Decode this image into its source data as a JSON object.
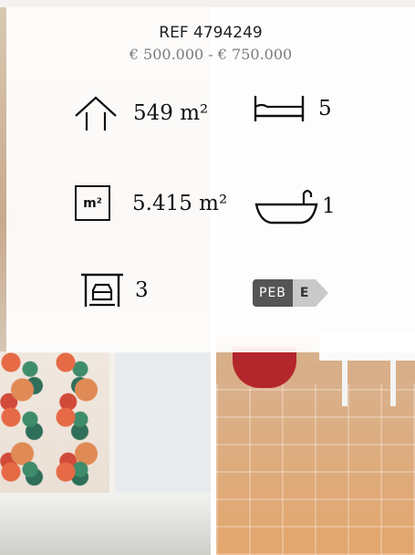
{
  "listing": {
    "reference": "REF 4794249",
    "price_range": "€ 500.000 - € 750.000"
  },
  "features": {
    "living_area": "549 m²",
    "bedrooms": "5",
    "land_area": "5.415 m²",
    "bathrooms": "1",
    "garages": "3",
    "land_icon_label": "m²",
    "peb_label": "PEB",
    "peb_class": "E"
  },
  "icons": [
    "house-icon",
    "bed-icon",
    "land-area-icon",
    "bathtub-icon",
    "garage-icon",
    "peb-badge"
  ],
  "colors": {
    "panel": "#ffffff",
    "price_text": "#7b7b7b",
    "peb_dark": "#555555",
    "peb_light": "#c9c9c9"
  }
}
